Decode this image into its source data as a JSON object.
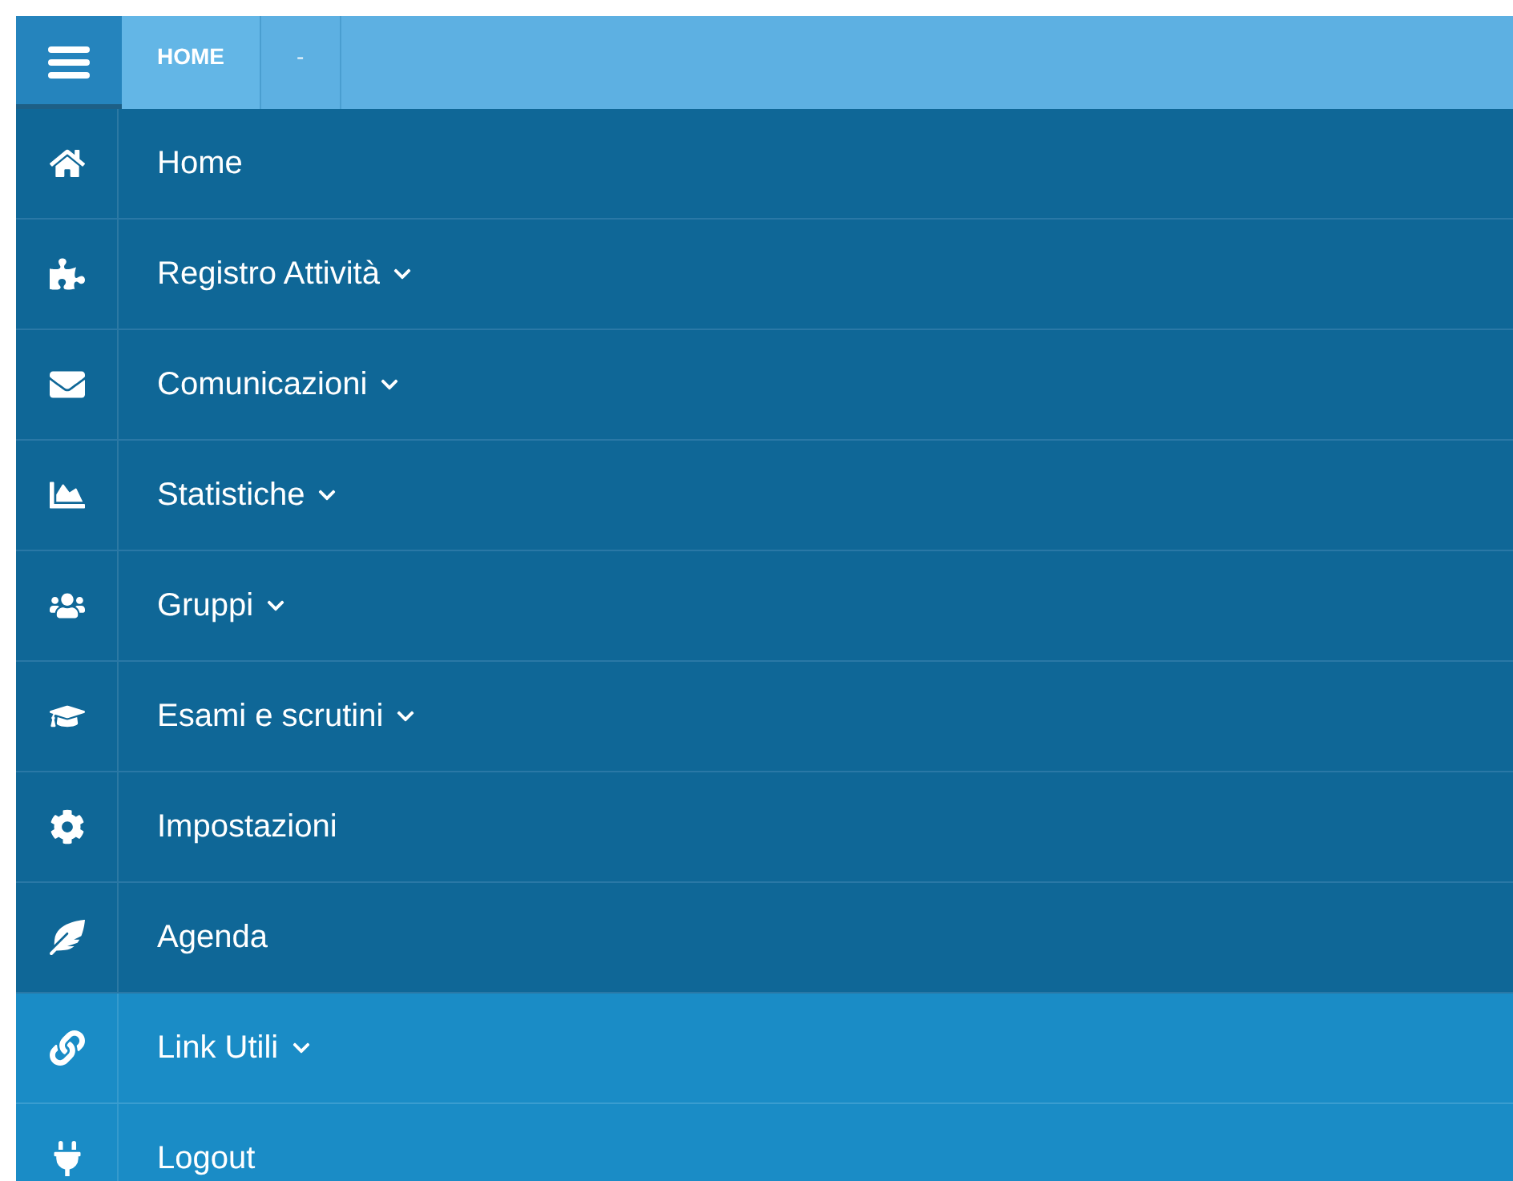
{
  "top_bar": {
    "tabs": [
      {
        "label": "HOME",
        "selected": true
      },
      {
        "label": "-",
        "selected": false
      }
    ]
  },
  "menu": [
    {
      "label": "Home",
      "kind": "main",
      "submenu": false
    },
    {
      "label": "Registro Attività",
      "kind": "main",
      "submenu": true
    },
    {
      "label": "Comunicazioni",
      "kind": "main",
      "submenu": true
    },
    {
      "label": "Statistiche",
      "kind": "main",
      "submenu": true
    },
    {
      "label": "Gruppi",
      "kind": "main",
      "submenu": true
    },
    {
      "label": "Esami e scrutini",
      "kind": "main",
      "submenu": true
    },
    {
      "label": "Impostazioni",
      "kind": "main",
      "submenu": false
    },
    {
      "label": "Agenda",
      "kind": "main",
      "submenu": false
    },
    {
      "label": "Link Utili",
      "kind": "extra",
      "submenu": true
    },
    {
      "label": "Logout",
      "kind": "extra",
      "submenu": false
    }
  ]
}
